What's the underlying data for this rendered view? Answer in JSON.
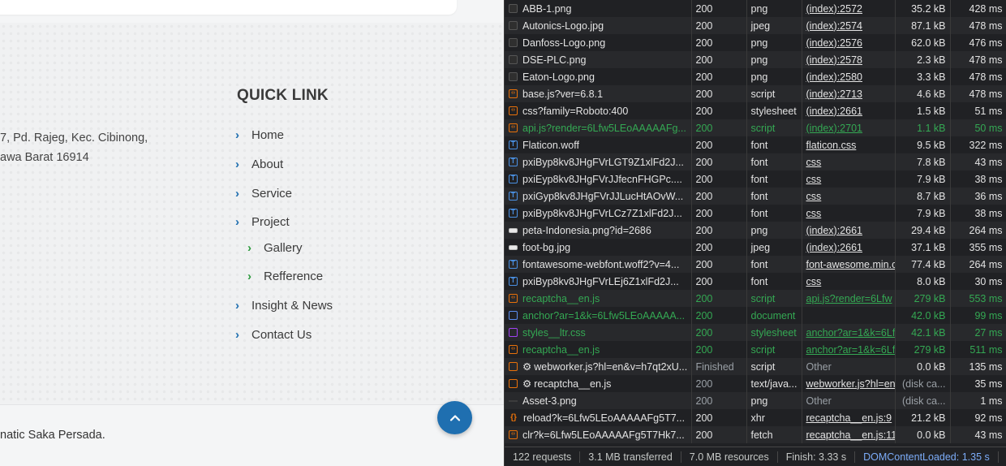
{
  "site": {
    "address_lines": [
      "7, Pd. Rajeg, Kec. Cibinong,",
      "awa Barat 16914"
    ],
    "quick_link_title": "QUICK LINK",
    "links": [
      {
        "label": "About",
        "id": "about"
      },
      {
        "label": "Service",
        "id": "service"
      },
      {
        "label": "Project",
        "id": "project"
      },
      {
        "label": "Gallery",
        "id": "gallery"
      },
      {
        "label": "Refference",
        "id": "refference"
      },
      {
        "label": "Insight & News",
        "id": "insight-news"
      },
      {
        "label": "Contact Us",
        "id": "contact-us"
      }
    ],
    "home_label": "Home",
    "copyright": "natic Saka Persada.",
    "back_to_top_icon": "chevron-up-icon",
    "colors": {
      "accent_blue": "#1f6fb0",
      "accent_green": "#2d9a3e"
    }
  },
  "devtools": {
    "rows": [
      {
        "name": "ABB-1.png",
        "status": "200",
        "type": "png",
        "initiator": "(index):2572",
        "size": "35.2 kB",
        "time": "428 ms",
        "icon": "image-icon"
      },
      {
        "name": "Autonics-Logo.jpg",
        "status": "200",
        "type": "jpeg",
        "initiator": "(index):2574",
        "size": "87.1 kB",
        "time": "478 ms",
        "icon": "image-icon"
      },
      {
        "name": "Danfoss-Logo.png",
        "status": "200",
        "type": "png",
        "initiator": "(index):2576",
        "size": "62.0 kB",
        "time": "476 ms",
        "icon": "image-icon"
      },
      {
        "name": "DSE-PLC.png",
        "status": "200",
        "type": "png",
        "initiator": "(index):2578",
        "size": "2.3 kB",
        "time": "478 ms",
        "icon": "image-icon"
      },
      {
        "name": "Eaton-Logo.png",
        "status": "200",
        "type": "png",
        "initiator": "(index):2580",
        "size": "3.3 kB",
        "time": "478 ms",
        "icon": "image-icon"
      },
      {
        "name": "base.js?ver=6.8.1",
        "status": "200",
        "type": "script",
        "initiator": "(index):2713",
        "size": "4.6 kB",
        "time": "478 ms",
        "icon": "script-icon"
      },
      {
        "name": "css?family=Roboto:400",
        "status": "200",
        "type": "stylesheet",
        "initiator": "(index):2661",
        "size": "1.5 kB",
        "time": "51 ms",
        "icon": "script-icon"
      },
      {
        "name": "api.js?render=6Lfw5LEoAAAAAFg...",
        "status": "200",
        "type": "script",
        "initiator": "(index):2701",
        "size": "1.1 kB",
        "time": "50 ms",
        "icon": "script-icon",
        "green": true
      },
      {
        "name": "Flaticon.woff",
        "status": "200",
        "type": "font",
        "initiator": "flaticon.css",
        "size": "9.5 kB",
        "time": "322 ms",
        "icon": "font-icon"
      },
      {
        "name": "pxiByp8kv8JHgFVrLGT9Z1xlFd2J...",
        "status": "200",
        "type": "font",
        "initiator": "css",
        "size": "7.8 kB",
        "time": "43 ms",
        "icon": "font-icon"
      },
      {
        "name": "pxiEyp8kv8JHgFVrJJfecnFHGPc....",
        "status": "200",
        "type": "font",
        "initiator": "css",
        "size": "7.9 kB",
        "time": "38 ms",
        "icon": "font-icon"
      },
      {
        "name": "pxiGyp8kv8JHgFVrJJLucHtAOvW...",
        "status": "200",
        "type": "font",
        "initiator": "css",
        "size": "8.7 kB",
        "time": "36 ms",
        "icon": "font-icon"
      },
      {
        "name": "pxiByp8kv8JHgFVrLCz7Z1xlFd2J...",
        "status": "200",
        "type": "font",
        "initiator": "css",
        "size": "7.9 kB",
        "time": "38 ms",
        "icon": "font-icon"
      },
      {
        "name": "peta-Indonesia.png?id=2686",
        "status": "200",
        "type": "png",
        "initiator": "(index):2661",
        "size": "29.4 kB",
        "time": "264 ms",
        "icon": "image-flat-icon"
      },
      {
        "name": "foot-bg.jpg",
        "status": "200",
        "type": "jpeg",
        "initiator": "(index):2661",
        "size": "37.1 kB",
        "time": "355 ms",
        "icon": "image-flat-icon"
      },
      {
        "name": "fontawesome-webfont.woff2?v=4...",
        "status": "200",
        "type": "font",
        "initiator": "font-awesome.min.c",
        "size": "77.4 kB",
        "time": "264 ms",
        "icon": "font-icon"
      },
      {
        "name": "pxiByp8kv8JHgFVrLEj6Z1xlFd2J...",
        "status": "200",
        "type": "font",
        "initiator": "css",
        "size": "8.0 kB",
        "time": "30 ms",
        "icon": "font-icon"
      },
      {
        "name": "recaptcha__en.js",
        "status": "200",
        "type": "script",
        "initiator": "api.js?render=6Lfw",
        "size": "279 kB",
        "time": "553 ms",
        "icon": "script-icon",
        "green": true
      },
      {
        "name": "anchor?ar=1&k=6Lfw5LEoAAAAA...",
        "status": "200",
        "type": "document",
        "initiator": "",
        "size": "42.0 kB",
        "time": "99 ms",
        "icon": "document-icon",
        "green": true
      },
      {
        "name": "styles__ltr.css",
        "status": "200",
        "type": "stylesheet",
        "initiator": "anchor?ar=1&k=6Lf",
        "size": "42.1 kB",
        "time": "27 ms",
        "icon": "stylesheet-icon",
        "green": true
      },
      {
        "name": "recaptcha__en.js",
        "status": "200",
        "type": "script",
        "initiator": "anchor?ar=1&k=6Lf",
        "size": "279 kB",
        "time": "511 ms",
        "icon": "script-icon",
        "green": true
      },
      {
        "name": "webworker.js?hl=en&v=h7qt2xU...",
        "status": "Finished",
        "type": "script",
        "initiator": "Other",
        "size": "0.0 kB",
        "time": "135 ms",
        "icon": "gear-icon",
        "gear": true,
        "muted_status": true,
        "muted_initiator": true
      },
      {
        "name": "recaptcha__en.js",
        "status": "200",
        "type": "text/java...",
        "initiator": "webworker.js?hl=en",
        "size": "(disk ca...",
        "time": "35 ms",
        "icon": "gear-icon",
        "gear": true,
        "muted_status": true,
        "muted_size": true
      },
      {
        "name": "Asset-3.png",
        "status": "200",
        "type": "png",
        "initiator": "Other",
        "size": "(disk ca...",
        "time": "1 ms",
        "icon": "dash-icon",
        "muted_status": true,
        "muted_initiator": true,
        "muted_size": true
      },
      {
        "name": "reload?k=6Lfw5LEoAAAAAFg5T7...",
        "status": "200",
        "type": "xhr",
        "initiator": "recaptcha__en.js:9",
        "size": "21.2 kB",
        "time": "92 ms",
        "icon": "xhr-icon"
      },
      {
        "name": "clr?k=6Lfw5LEoAAAAAFg5T7Hk7...",
        "status": "200",
        "type": "fetch",
        "initiator": "recaptcha__en.js:11",
        "size": "0.0 kB",
        "time": "43 ms",
        "icon": "script-icon"
      }
    ],
    "summary": {
      "requests": "122 requests",
      "transferred": "3.1 MB transferred",
      "resources": "7.0 MB resources",
      "finish": "Finish: 3.33 s",
      "dcl": "DOMContentLoaded: 1.35 s"
    },
    "colors": {
      "green": "#34a853",
      "blue": "#7cacf8",
      "orange": "#e8710a"
    }
  }
}
